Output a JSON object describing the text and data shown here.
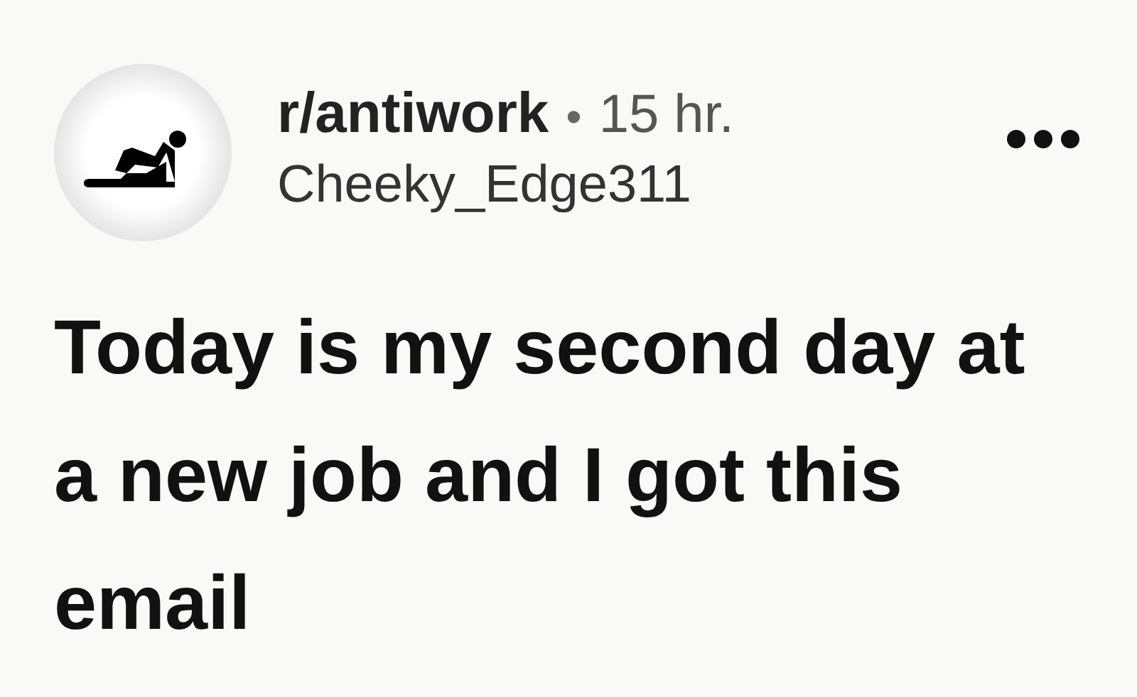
{
  "post": {
    "community": "r/antiwork",
    "separator": "•",
    "age": "15 hr.",
    "author": "Cheeky_Edge311",
    "title": "Today is my second day at a new job and I got this email"
  }
}
